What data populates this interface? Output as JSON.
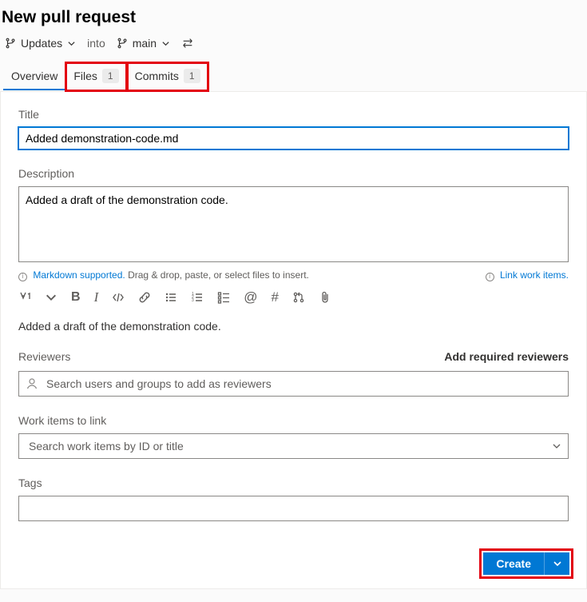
{
  "header": {
    "title": "New pull request",
    "source_branch": "Updates",
    "into_label": "into",
    "target_branch": "main"
  },
  "tabs": {
    "overview": {
      "label": "Overview"
    },
    "files": {
      "label": "Files",
      "count": "1"
    },
    "commits": {
      "label": "Commits",
      "count": "1"
    }
  },
  "form": {
    "title_label": "Title",
    "title_value": "Added demonstration-code.md",
    "description_label": "Description",
    "description_value": "Added a draft of the demonstration code.",
    "markdown_link": "Markdown supported.",
    "markdown_hint": " Drag & drop, paste, or select files to insert.",
    "link_work_items": "Link work items.",
    "preview_text": "Added a draft of the demonstration code.",
    "reviewers_label": "Reviewers",
    "add_required": "Add required reviewers",
    "reviewers_placeholder": "Search users and groups to add as reviewers",
    "work_items_label": "Work items to link",
    "work_items_placeholder": "Search work items by ID or title",
    "tags_label": "Tags"
  },
  "actions": {
    "create": "Create"
  }
}
